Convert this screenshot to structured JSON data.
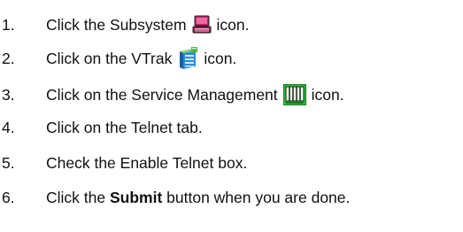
{
  "steps": [
    {
      "num": "1.",
      "before": "Click the Subsystem",
      "icon": "subsystem-icon",
      "after": "icon."
    },
    {
      "num": "2.",
      "before": "Click on the VTrak",
      "icon": "vtrak-icon",
      "after": "icon."
    },
    {
      "num": "3.",
      "before": "Click on the Service Management",
      "icon": "service-management-icon",
      "after": "icon."
    },
    {
      "num": "4.",
      "text": "Click on the Telnet tab."
    },
    {
      "num": "5.",
      "text": "Check the Enable Telnet box."
    },
    {
      "num": "6.",
      "before": "Click the ",
      "bold": "Submit",
      "after": " button when you are done."
    }
  ],
  "colors": {
    "text": "#111111",
    "subsystem_icon": "#c4256a",
    "vtrak_icon": "#2a8fd6",
    "service_icon": "#2fbf3a"
  }
}
